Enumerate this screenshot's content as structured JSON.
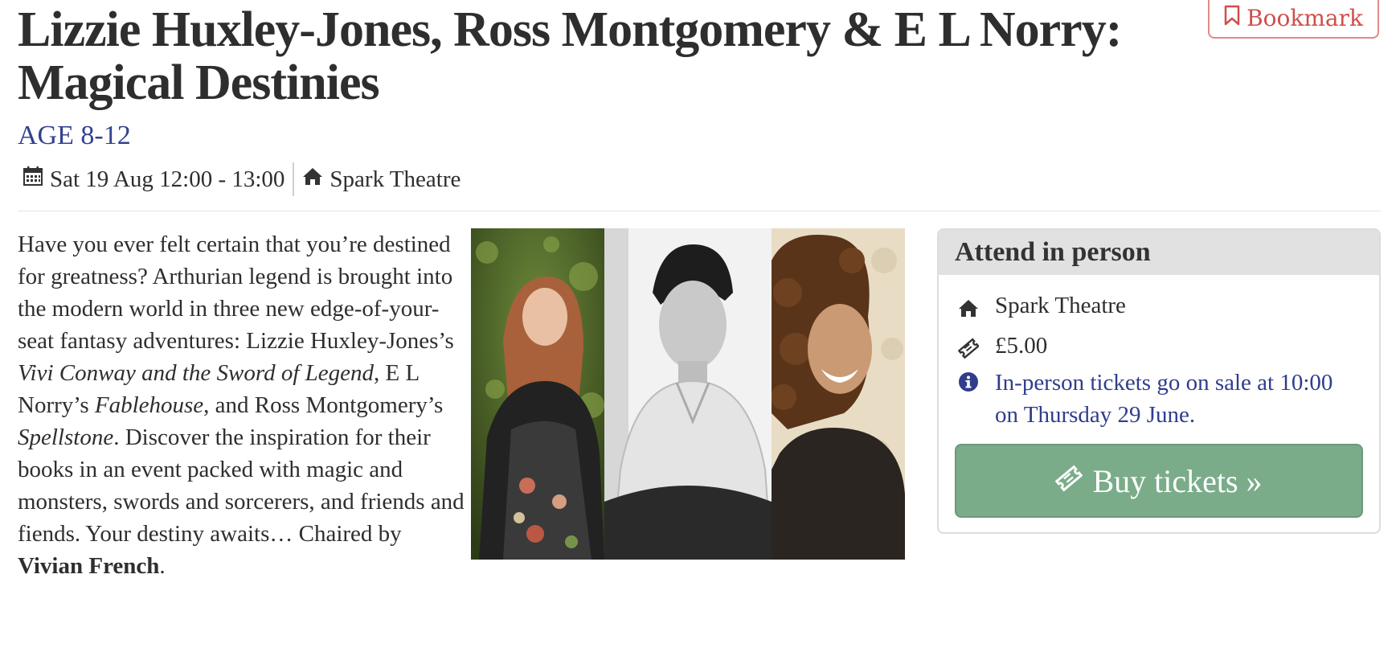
{
  "bookmark": {
    "label": "Bookmark",
    "icon": "bookmark-icon"
  },
  "event": {
    "title": "Lizzie Huxley-Jones, Ross Montgomery & E L Norry: Magical Destinies",
    "age": "AGE 8-12",
    "datetime": "Sat 19 Aug 12:00 - 13:00",
    "venue": "Spark Theatre"
  },
  "description": {
    "p1": "Have you ever felt certain that you’re destined for greatness? Arthurian legend is brought into the modern world in three new edge-of-your-seat fantasy adventures: Lizzie Huxley-Jones’s ",
    "book1": "Vivi Conway and the Sword of Legend",
    "p2": ", E L Norry’s ",
    "book2": "Fablehouse",
    "p3": ", and Ross Montgomery’s ",
    "book3": "Spellstone",
    "p4": ". Discover the inspiration for their books in an event packed with magic and monsters, swords and sorcerers, and friends and fiends. Your destiny awaits… Chaired by ",
    "chair": "Vivian French",
    "p5": "."
  },
  "attend": {
    "heading": "Attend in person",
    "venue": "Spark Theatre",
    "price": "£5.00",
    "info": "In-person tickets go on sale at 10:00 on Thursday 29 June.",
    "buy_label": "Buy tickets »"
  },
  "colors": {
    "accent_red": "#cf4f4a",
    "accent_blue": "#33418f",
    "buy_green": "#7aac8a"
  }
}
